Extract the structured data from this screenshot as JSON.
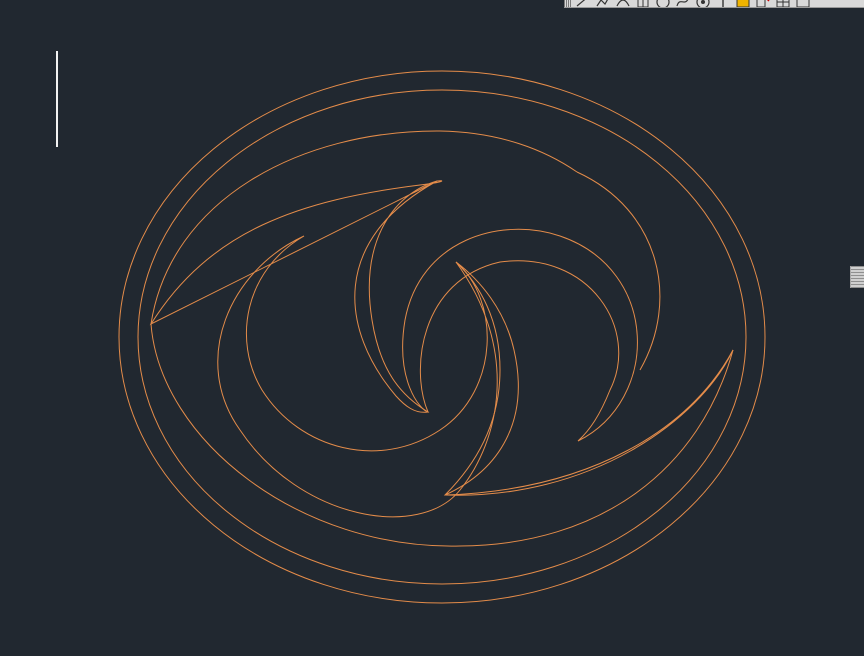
{
  "canvas": {
    "background_color": "#212830",
    "entity_color": "#e48c4a",
    "crosshair_color": "#f2f2f2"
  },
  "toolbar": {
    "buttons": [
      {
        "name": "line-icon"
      },
      {
        "name": "polyline-icon"
      },
      {
        "name": "arc-icon"
      },
      {
        "name": "grid-icon"
      },
      {
        "name": "circle-icon"
      },
      {
        "name": "spline-icon"
      },
      {
        "name": "revcloud-icon"
      },
      {
        "name": "text-icon"
      },
      {
        "name": "hatch-icon"
      },
      {
        "name": "insert-block-icon"
      },
      {
        "name": "table-icon"
      },
      {
        "name": "window-icon"
      }
    ]
  }
}
